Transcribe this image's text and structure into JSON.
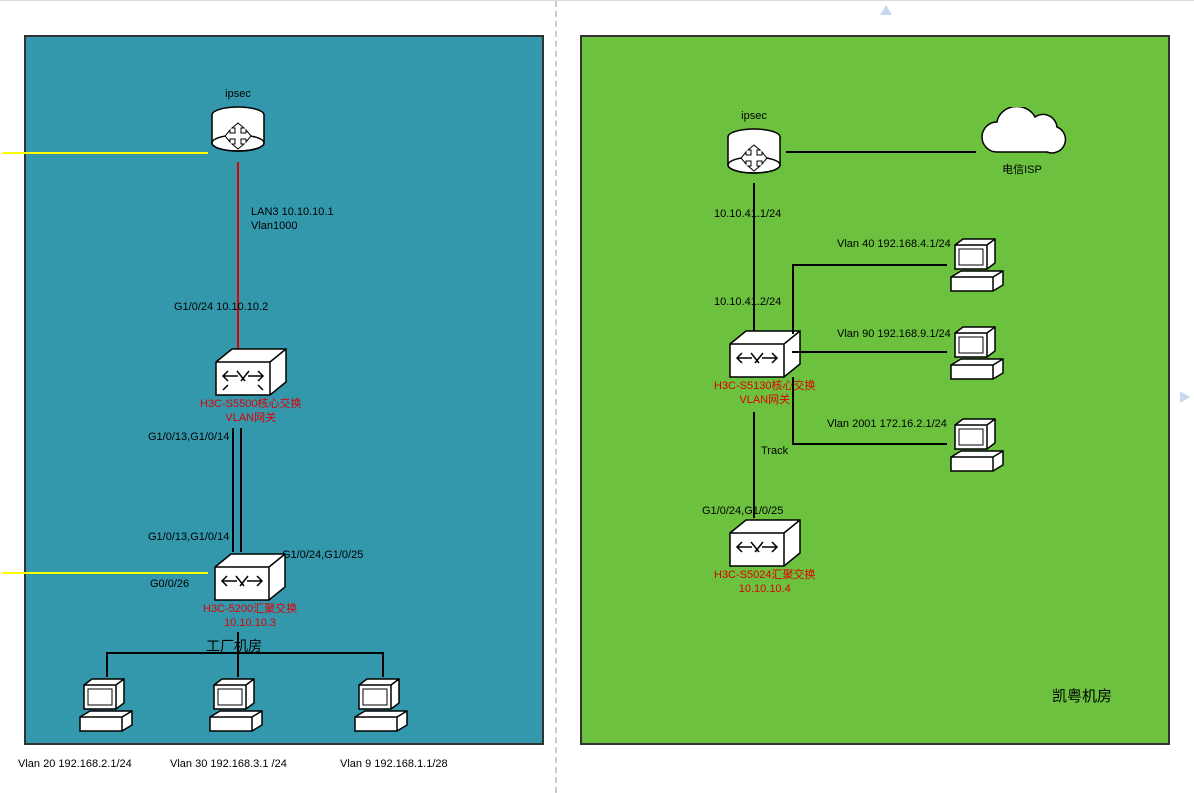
{
  "left_panel": {
    "title": "工厂机房",
    "ipsec": "ipsec",
    "router_lan3": "LAN3 10.10.10.1",
    "router_vlan": "Vlan1000",
    "core_port": "G1/0/24 10.10.10.2",
    "core_name": "H3C-S5500核心交换",
    "core_gateway": "VLAN网关",
    "core_trunk1": "G1/0/13,G1/0/14",
    "agg_trunk1": "G1/0/13,G1/0/14",
    "agg_ports": "G1/0/24,G1/0/25",
    "agg_port_g0": "G0/0/26",
    "agg_name": "H3C-5200汇聚交换",
    "agg_ip": "10.10.10.3",
    "vlan20": "Vlan 20 192.168.2.1/24",
    "vlan30": "Vlan 30 192.168.3.1 /24",
    "vlan9": "Vlan 9 192.168.1.1/28"
  },
  "right_panel": {
    "title": "凯粤机房",
    "ipsec": "ipsec",
    "isp": "电信ISP",
    "router_ip": "10.10.41.1/24",
    "core_port": "10.10.41.2/24",
    "core_name": "H3C-S5130核心交换",
    "core_gateway": "VLAN网关",
    "vlan40": "Vlan 40 192.168.4.1/24",
    "vlan90": "Vlan 90 192.168.9.1/24",
    "vlan2001": "Vlan 2001 172.16.2.1/24",
    "track": "Track",
    "agg_ports": "G1/0/24,G1/0/25",
    "agg_name": "H3C-S5024汇聚交换",
    "agg_ip": "10.10.10.4"
  }
}
